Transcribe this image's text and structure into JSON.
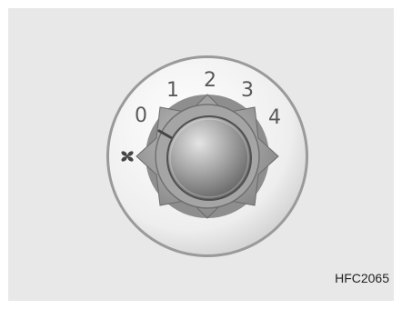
{
  "knob": {
    "name": "fan-speed-control-knob",
    "positions": [
      "0",
      "1",
      "2",
      "3",
      "4"
    ],
    "selected_position": "0",
    "symbol_icon": "fan-icon"
  },
  "figure_code": "HFC2065",
  "colors": {
    "background": "#e8e8e8",
    "bezel": "#f2f2f2",
    "bezel_edge": "#8a8a8a",
    "star_housing": "#9a9a9a",
    "knob_light": "#d8d8d8",
    "knob_dark": "#6e6e6e",
    "numeral": "#5a5a5a"
  }
}
